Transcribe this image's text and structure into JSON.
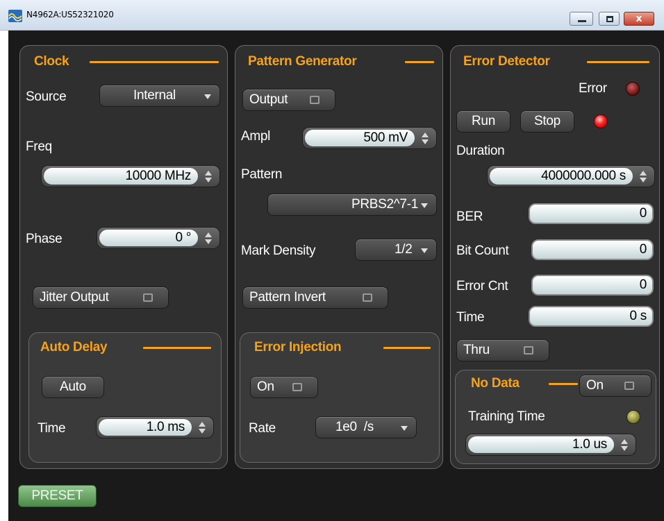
{
  "window": {
    "title": "N4962A:US52321020",
    "icon": "app-icon",
    "controls": {
      "minimize": "minimize-icon",
      "maximize": "maximize-icon",
      "close": "x"
    }
  },
  "clock": {
    "title": "Clock",
    "source_label": "Source",
    "source_value": "Internal",
    "freq_label": "Freq",
    "freq_value": "10000 MHz",
    "phase_label": "Phase",
    "phase_value": "0 °",
    "jitter_output_label": "Jitter Output",
    "auto_delay": {
      "title": "Auto Delay",
      "auto_label": "Auto",
      "time_label": "Time",
      "time_value": "1.0 ms"
    }
  },
  "pattern_generator": {
    "title": "Pattern Generator",
    "output_label": "Output",
    "ampl_label": "Ampl",
    "ampl_value": "500 mV",
    "pattern_label": "Pattern",
    "pattern_value": "PRBS2^7-1",
    "mark_density_label": "Mark Density",
    "mark_density_value": "1/2",
    "pattern_invert_label": "Pattern Invert",
    "error_injection": {
      "title": "Error Injection",
      "on_label": "On",
      "rate_label": "Rate",
      "rate_value": "1e0  /s"
    }
  },
  "error_detector": {
    "title": "Error Detector",
    "error_label": "Error",
    "run_label": "Run",
    "stop_label": "Stop",
    "duration_label": "Duration",
    "duration_value": "4000000.000 s",
    "ber_label": "BER",
    "ber_value": "0",
    "bit_count_label": "Bit Count",
    "bit_count_value": "0",
    "error_cnt_label": "Error Cnt",
    "error_cnt_value": "0",
    "time_label": "Time",
    "time_value": "0 s",
    "thru_label": "Thru",
    "no_data": {
      "title": "No Data",
      "on_label": "On",
      "training_time_label": "Training Time",
      "training_time_value": "1.0 us"
    }
  },
  "preset_label": "PRESET",
  "colors": {
    "accent": "#f5a21c",
    "panel_bg": "#2f2f2f",
    "window_bg": "#1a1a1a",
    "preset_green": "#5f9a5b",
    "led_error": "#ff2a2a"
  }
}
